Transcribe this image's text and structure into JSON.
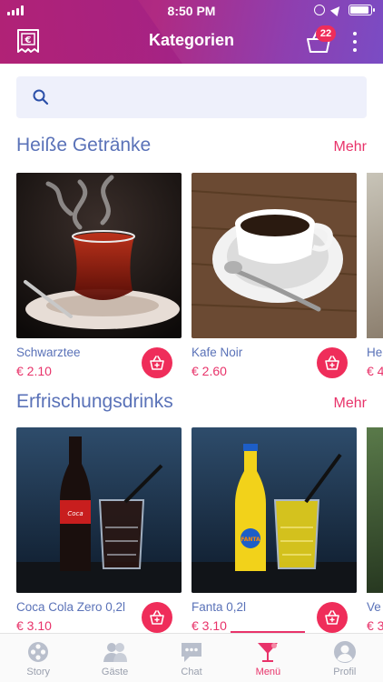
{
  "status_bar": {
    "time": "8:50 PM"
  },
  "header": {
    "title": "Kategorien",
    "basket_count": "22"
  },
  "search": {
    "placeholder": ""
  },
  "sections": [
    {
      "title": "Heiße Getränke",
      "more_label": "Mehr",
      "items": [
        {
          "name": "Schwarztee",
          "price": "€ 2.10"
        },
        {
          "name": "Kafe Noir",
          "price": "€ 2.60"
        },
        {
          "name": "He",
          "price": "€ 4"
        }
      ]
    },
    {
      "title": "Erfrischungsdrinks",
      "more_label": "Mehr",
      "items": [
        {
          "name": "Coca Cola Zero 0,2l",
          "price": "€ 3.10"
        },
        {
          "name": "Fanta 0,2l",
          "price": "€ 3.10"
        },
        {
          "name": "Ve",
          "price": "€ 3"
        }
      ]
    }
  ],
  "tabs": [
    {
      "label": "Story",
      "icon": "film-reel-icon"
    },
    {
      "label": "Gäste",
      "icon": "guests-icon"
    },
    {
      "label": "Chat",
      "icon": "chat-icon"
    },
    {
      "label": "Menü",
      "icon": "cocktail-icon",
      "active": true
    },
    {
      "label": "Profil",
      "icon": "profile-icon"
    }
  ],
  "colors": {
    "accent": "#e8336a",
    "section_title": "#5a72b8",
    "header_start": "#9c1a7c",
    "header_end": "#7a4cc4"
  }
}
